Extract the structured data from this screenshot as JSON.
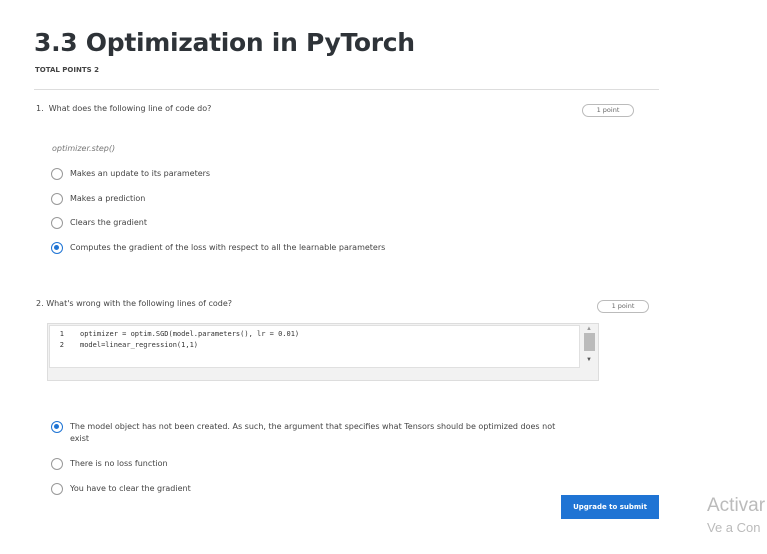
{
  "title": "3.3 Optimization in PyTorch",
  "total_points": "TOTAL POINTS 2",
  "questions": [
    {
      "number": "1.",
      "text": "What does the following line of code do?",
      "points": "1 point",
      "code": "optimizer.step()",
      "options": [
        "Makes an update to its parameters",
        "Makes a prediction",
        "Clears the gradient",
        "Computes the gradient of the loss with respect to all the learnable parameters"
      ],
      "selected": 3
    },
    {
      "number": "2.",
      "text": "What's wrong with the following lines of code?",
      "points": "1 point",
      "code_lines": [
        {
          "n": "1",
          "code": "optimizer = optim.SGD(model.parameters(), lr = 0.01)"
        },
        {
          "n": "2",
          "code": "model=linear_regression(1,1)"
        }
      ],
      "options": [
        "The model object has not been created. As such, the argument that specifies what Tensors should be optimized does not exist",
        "There is no loss function",
        "You have to clear the gradient"
      ],
      "selected": 0
    }
  ],
  "submit_label": "Upgrade to submit",
  "watermark": {
    "line1": "Activar",
    "line2": "Ve a Con"
  }
}
